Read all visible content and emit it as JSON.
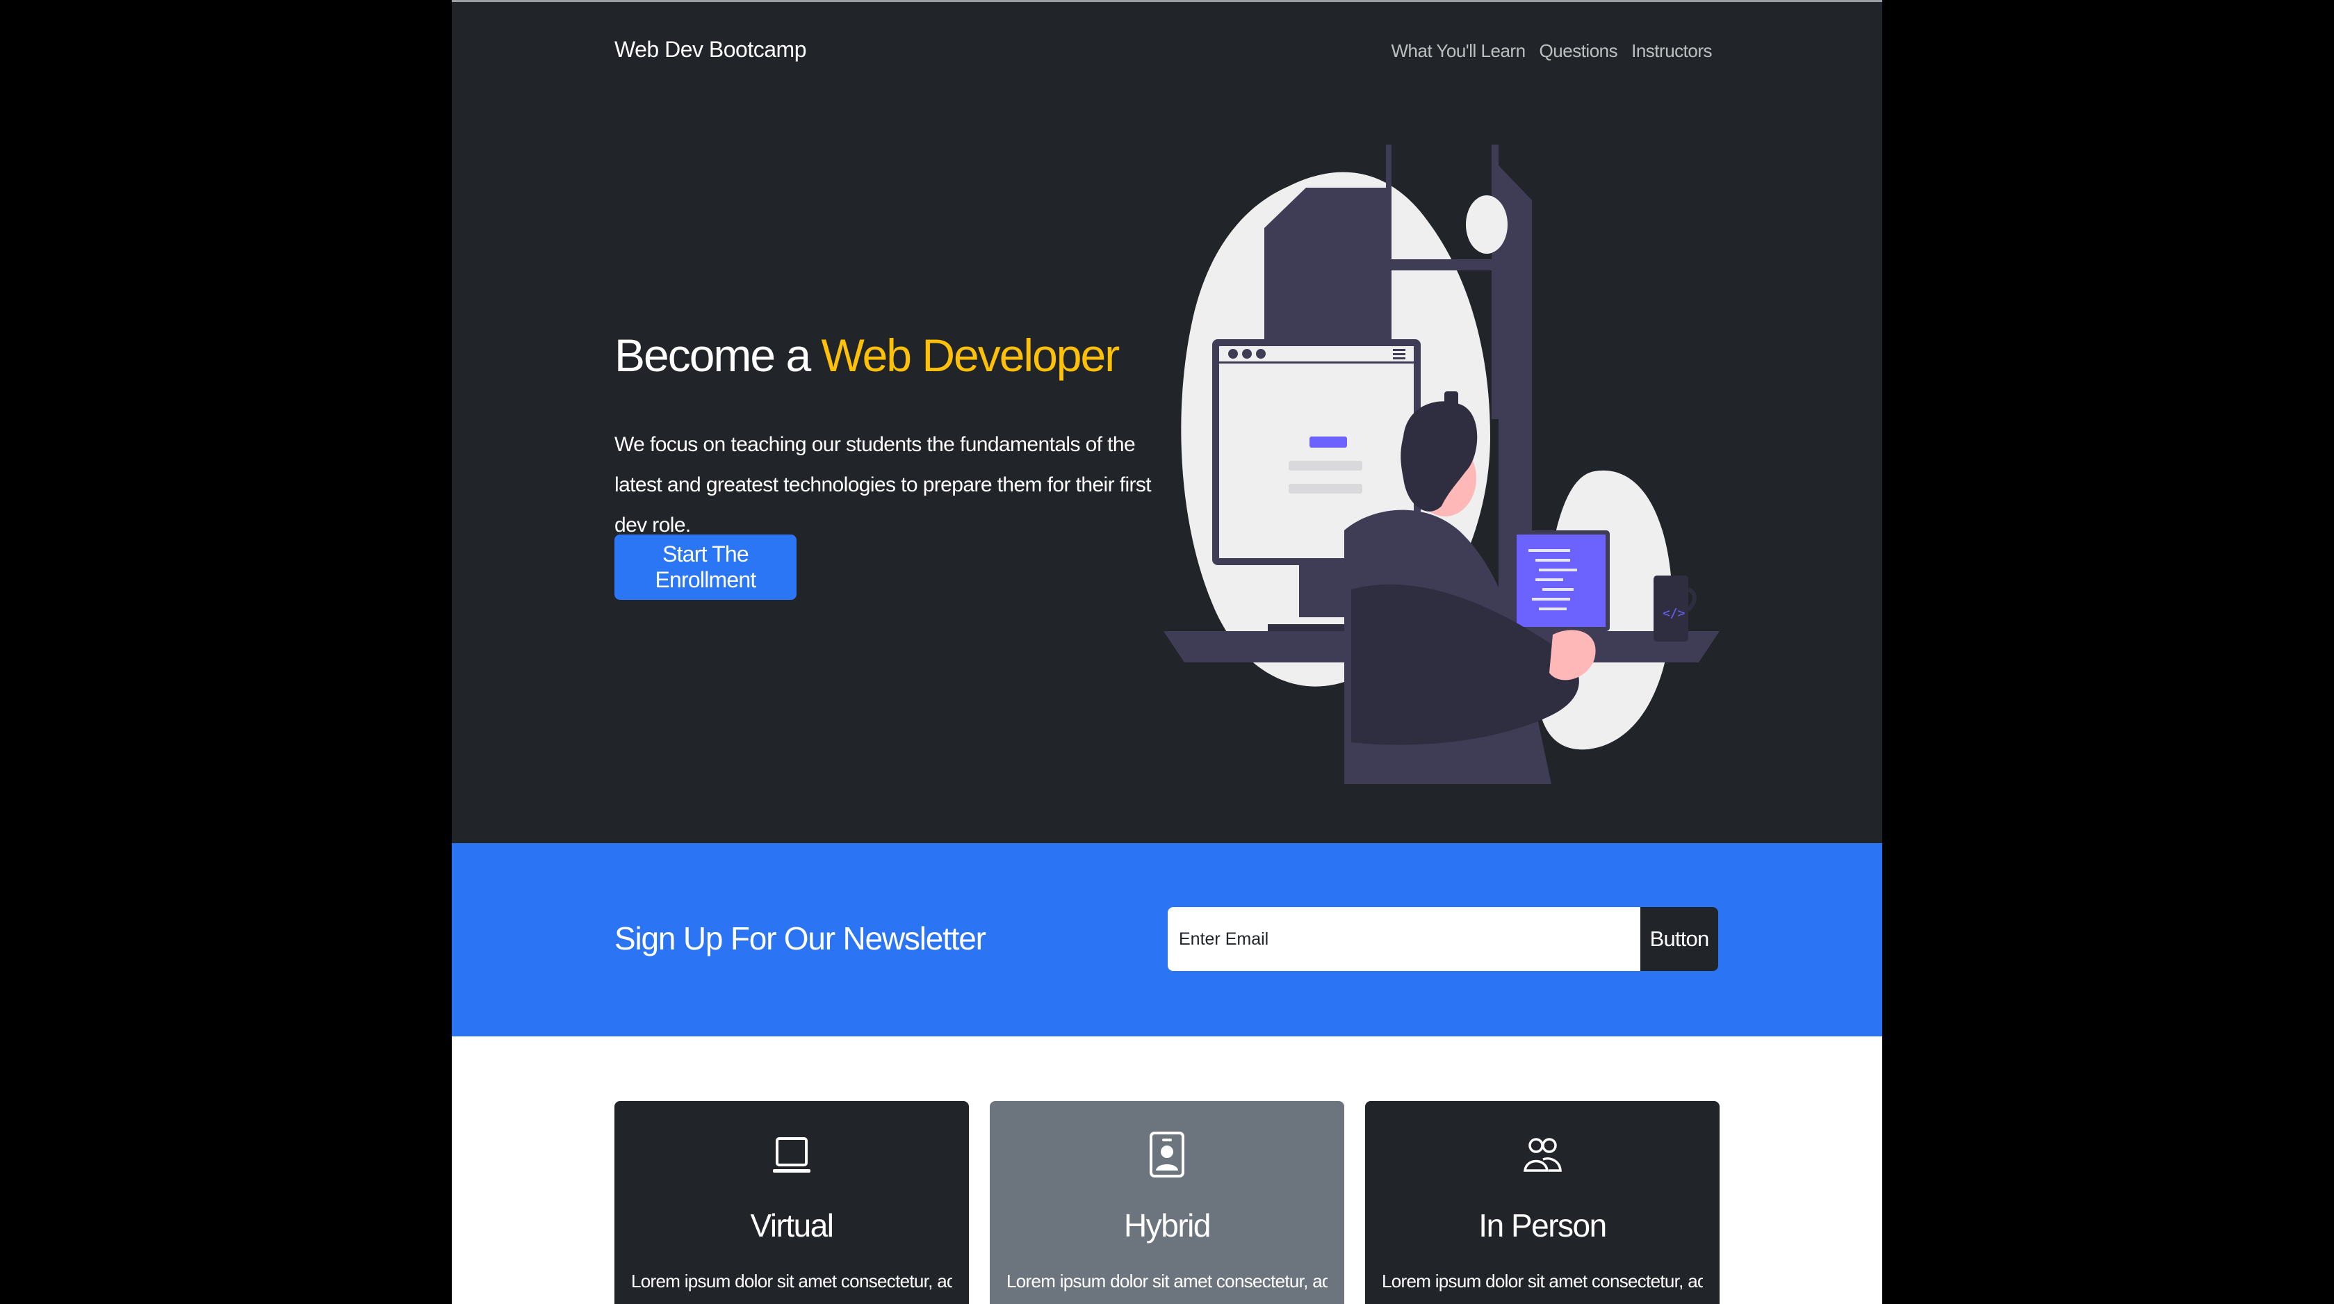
{
  "navbar": {
    "brand": "Web Dev Bootcamp",
    "links": [
      "What You'll Learn",
      "Questions",
      "Instructors"
    ]
  },
  "hero": {
    "title_prefix": "Become a ",
    "title_accent": "Web Developer",
    "text": "We focus on teaching our students the fundamentals of the latest and greatest technologies to prepare them for their first dev role.",
    "cta_label": "Start The Enrollment",
    "illustration_icon": "developer-at-desk-illustration"
  },
  "newsletter": {
    "title": "Sign Up For Our Newsletter",
    "email_placeholder": "Enter Email",
    "email_value": "",
    "button_label": "Button"
  },
  "boxes": [
    {
      "icon": "laptop-icon",
      "title": "Virtual",
      "text": "Lorem ipsum dolor sit amet consectetur, adipisicing",
      "theme": "dark"
    },
    {
      "icon": "person-badge-icon",
      "title": "Hybrid",
      "text": "Lorem ipsum dolor sit amet consectetur, adipisicing",
      "theme": "gray"
    },
    {
      "icon": "people-icon",
      "title": "In Person",
      "text": "Lorem ipsum dolor sit amet consectetur, adipisicing",
      "theme": "dark"
    }
  ],
  "colors": {
    "dark_bg": "#212529",
    "accent_yellow": "#ffc107",
    "primary_blue": "#2b74f3",
    "secondary_gray": "#6c757d"
  }
}
